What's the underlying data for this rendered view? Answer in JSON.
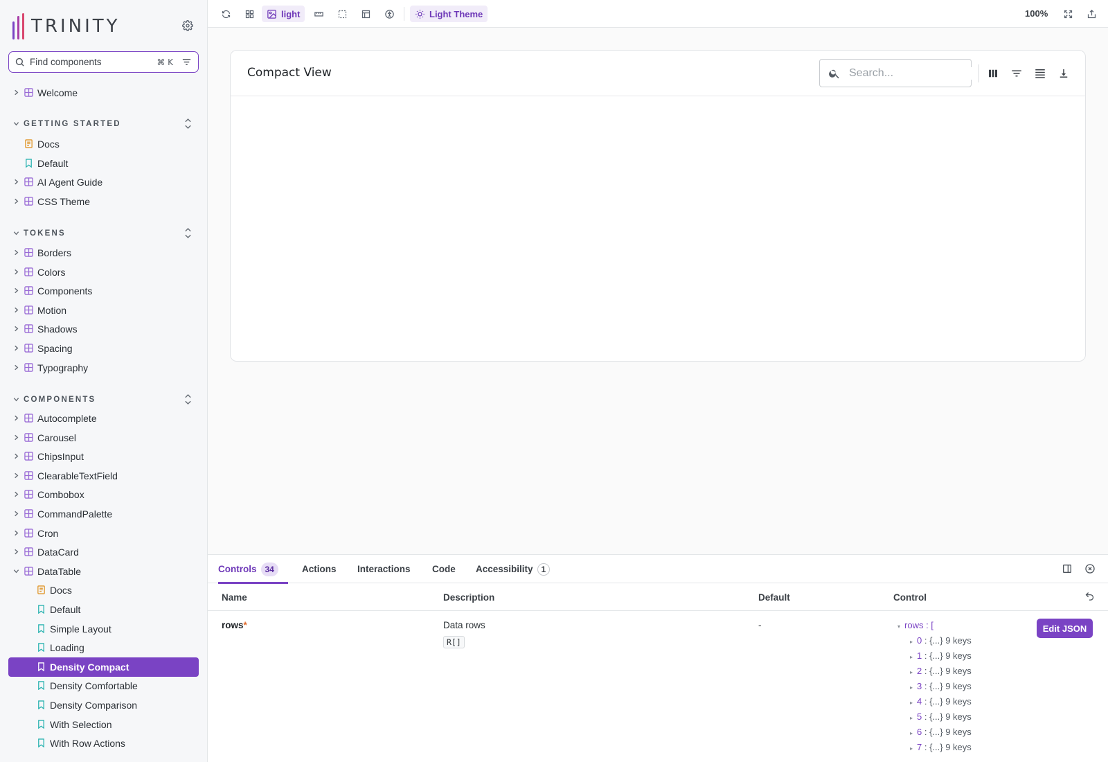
{
  "sidebar": {
    "brand": "TRINITY",
    "search": {
      "placeholder": "Find components",
      "shortcut": "⌘ K"
    },
    "welcome": "Welcome",
    "sections": {
      "getting_started": {
        "title": "GETTING STARTED",
        "items": [
          "Docs",
          "Default",
          "AI Agent Guide",
          "CSS Theme"
        ]
      },
      "tokens": {
        "title": "TOKENS",
        "items": [
          "Borders",
          "Colors",
          "Components",
          "Motion",
          "Shadows",
          "Spacing",
          "Typography"
        ]
      },
      "components": {
        "title": "COMPONENTS",
        "items": [
          "Autocomplete",
          "Carousel",
          "ChipsInput",
          "ClearableTextField",
          "Combobox",
          "CommandPalette",
          "Cron",
          "DataCard",
          "DataTable"
        ],
        "datatable_children": [
          "Docs",
          "Default",
          "Simple Layout",
          "Loading",
          "Density Compact",
          "Density Comfortable",
          "Density Comparison",
          "With Selection",
          "With Row Actions"
        ]
      }
    }
  },
  "toolbar": {
    "background_label": "light",
    "theme_label": "Light Theme",
    "zoom": "100%"
  },
  "preview": {
    "title": "Compact View",
    "search_placeholder": "Search..."
  },
  "addon": {
    "tabs": [
      {
        "label": "Controls",
        "badge": "34"
      },
      {
        "label": "Actions"
      },
      {
        "label": "Interactions"
      },
      {
        "label": "Code"
      },
      {
        "label": "Accessibility",
        "badge": "1"
      }
    ],
    "headers": [
      "Name",
      "Description",
      "Default",
      "Control"
    ],
    "row": {
      "name": "rows",
      "required_mark": "*",
      "description": "Data rows",
      "type": "R[]",
      "default": "-",
      "json_root": "rows : [",
      "entries": [
        {
          "key": "0",
          "value": " : {...} 9 keys"
        },
        {
          "key": "1",
          "value": " : {...} 9 keys"
        },
        {
          "key": "2",
          "value": " : {...} 9 keys"
        },
        {
          "key": "3",
          "value": " : {...} 9 keys"
        },
        {
          "key": "4",
          "value": " : {...} 9 keys"
        },
        {
          "key": "5",
          "value": " : {...} 9 keys"
        },
        {
          "key": "6",
          "value": " : {...} 9 keys"
        },
        {
          "key": "7",
          "value": " : {...} 9 keys"
        }
      ],
      "edit_label": "Edit JSON"
    }
  },
  "colors": {
    "accent": "#7a43c4",
    "component_icon": "#9a6bd6",
    "docs_icon": "#e0962a",
    "story_icon": "#2ab3b0"
  }
}
